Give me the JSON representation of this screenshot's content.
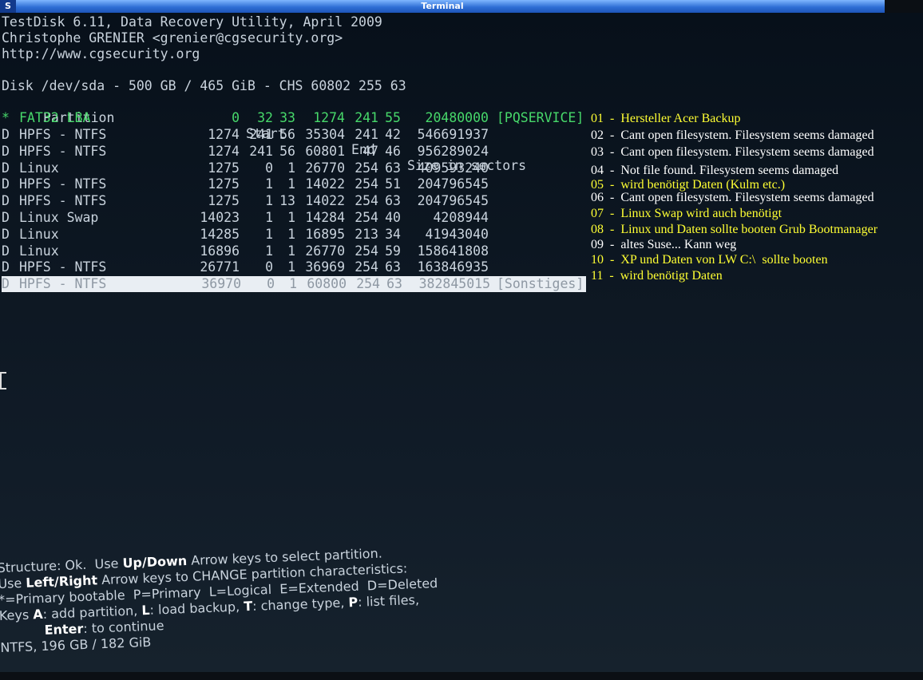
{
  "window": {
    "title": "Terminal",
    "sys_icon": "S"
  },
  "header": {
    "line1": "TestDisk 6.11, Data Recovery Utility, April 2009",
    "line2": "Christophe GRENIER <grenier@cgsecurity.org>",
    "line3": "http://www.cgsecurity.org",
    "disk": "Disk /dev/sda - 500 GB / 465 GiB - CHS 60802 255 63"
  },
  "table": {
    "headers": {
      "partition": "Partition",
      "start": "Start",
      "end": "End",
      "size": "Size in sectors"
    },
    "rows": [
      {
        "flag": "*",
        "type": "FAT32 LBA",
        "s_c": "0",
        "s_h": "32",
        "s_s": "33",
        "e_c": "1274",
        "e_h": "241",
        "e_s": "55",
        "size": "20480000",
        "label": "[PQSERVICE]"
      },
      {
        "flag": "D",
        "type": "HPFS - NTFS",
        "s_c": "1274",
        "s_h": "241",
        "s_s": "56",
        "e_c": "35304",
        "e_h": "241",
        "e_s": "42",
        "size": "546691937",
        "label": ""
      },
      {
        "flag": "D",
        "type": "HPFS - NTFS",
        "s_c": "1274",
        "s_h": "241",
        "s_s": "56",
        "e_c": "60801",
        "e_h": "47",
        "e_s": "46",
        "size": "956289024",
        "label": ""
      },
      {
        "flag": "D",
        "type": "Linux",
        "s_c": "1275",
        "s_h": "0",
        "s_s": "1",
        "e_c": "26770",
        "e_h": "254",
        "e_s": "63",
        "size": "409593240",
        "label": ""
      },
      {
        "flag": "D",
        "type": "HPFS - NTFS",
        "s_c": "1275",
        "s_h": "1",
        "s_s": "1",
        "e_c": "14022",
        "e_h": "254",
        "e_s": "51",
        "size": "204796545",
        "label": ""
      },
      {
        "flag": "D",
        "type": "HPFS - NTFS",
        "s_c": "1275",
        "s_h": "1",
        "s_s": "13",
        "e_c": "14022",
        "e_h": "254",
        "e_s": "63",
        "size": "204796545",
        "label": ""
      },
      {
        "flag": "D",
        "type": "Linux Swap",
        "s_c": "14023",
        "s_h": "1",
        "s_s": "1",
        "e_c": "14284",
        "e_h": "254",
        "e_s": "40",
        "size": "4208944",
        "label": ""
      },
      {
        "flag": "D",
        "type": "Linux",
        "s_c": "14285",
        "s_h": "1",
        "s_s": "1",
        "e_c": "16895",
        "e_h": "213",
        "e_s": "34",
        "size": "41943040",
        "label": ""
      },
      {
        "flag": "D",
        "type": "Linux",
        "s_c": "16896",
        "s_h": "1",
        "s_s": "1",
        "e_c": "26770",
        "e_h": "254",
        "e_s": "59",
        "size": "158641808",
        "label": ""
      },
      {
        "flag": "D",
        "type": "HPFS - NTFS",
        "s_c": "26771",
        "s_h": "0",
        "s_s": "1",
        "e_c": "36969",
        "e_h": "254",
        "e_s": "63",
        "size": "163846935",
        "label": ""
      },
      {
        "flag": "D",
        "type": "HPFS - NTFS",
        "s_c": "36970",
        "s_h": "0",
        "s_s": "1",
        "e_c": "60800",
        "e_h": "254",
        "e_s": "63",
        "size": "382845015",
        "label": "[Sonstiges]"
      }
    ]
  },
  "annotations": [
    {
      "text": "01  -  Hersteller Acer Backup",
      "color": "#ffff33"
    },
    {
      "text": "02  -  Cant open filesystem. Filesystem seems damaged",
      "color": "#ffffff"
    },
    {
      "text": "03  -  Cant open filesystem. Filesystem seems damaged",
      "color": "#ffffff"
    },
    {
      "text": "04  -  Not file found. Filesystem seems damaged",
      "color": "#ffffff"
    },
    {
      "text": "05  -  wird benötigt Daten (Kulm etc.)",
      "color": "#ffff33"
    },
    {
      "text": "06  -  Cant open filesystem. Filesystem seems damaged",
      "color": "#ffffff"
    },
    {
      "text": "07  -  Linux Swap wird auch benötigt",
      "color": "#ffff33"
    },
    {
      "text": "08  -  Linux und Daten sollte booten Grub Bootmanager",
      "color": "#ffff33"
    },
    {
      "text": "09  -  altes Suse... Kann weg",
      "color": "#ffffff"
    },
    {
      "text": "10  -  XP und Daten von LW C:\\  sollte booten",
      "color": "#ffff33"
    },
    {
      "text": "11  -  wird benötigt Daten",
      "color": "#ffff33"
    }
  ],
  "footer": {
    "l1a": "Structure: Ok.  Use ",
    "l1b": "Up/Down",
    "l1c": " Arrow keys to select partition.",
    "l2a": "Use ",
    "l2b": "Left/Right",
    "l2c": " Arrow keys to CHANGE partition characteristics:",
    "l3": "*=Primary bootable  P=Primary  L=Logical  E=Extended  D=Deleted",
    "l4a": "Keys ",
    "l4b": "A",
    "l4c": ": add partition, ",
    "l4d": "L",
    "l4e": ": load backup, ",
    "l4f": "T",
    "l4g": ": change type, ",
    "l4h": "P",
    "l4i": ": list files,",
    "l5a": "Enter",
    "l5b": ": to continue",
    "l6": "NTFS, 196 GB / 182 GiB"
  }
}
